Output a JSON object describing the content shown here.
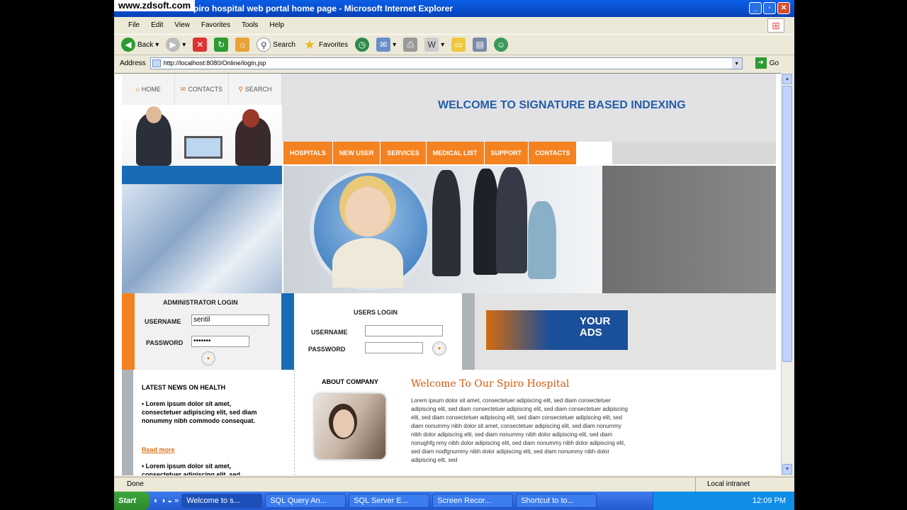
{
  "window": {
    "watermark": "www.zdsoft.com",
    "title": "Spiro hospital web portal home page - Microsoft Internet Explorer",
    "buttons": [
      "_",
      "▫",
      "✕"
    ]
  },
  "menubar": [
    "File",
    "Edit",
    "View",
    "Favorites",
    "Tools",
    "Help"
  ],
  "toolbar": {
    "back": "Back",
    "search": "Search",
    "favorites": "Favorites"
  },
  "address": {
    "label": "Address",
    "url": "http://localhost:8080/Online/login.jsp",
    "go": "Go"
  },
  "page": {
    "topnav": [
      "HOME",
      "CONTACTS",
      "SEARCH"
    ],
    "welcome": "WELCOME TO SIGNATURE BASED INDEXING",
    "orangenav": [
      "HOSPITALS",
      "NEW USER",
      "SERVICES",
      "MEDICAL LIST",
      "SUPPORT",
      "CONTACTS"
    ],
    "admin": {
      "title": "ADMINISTRATOR LOGIN",
      "username_label": "USERNAME",
      "username_value": "sentil",
      "password_label": "PASSWORD",
      "password_value": "•••••••"
    },
    "users": {
      "title": "USERS LOGIN",
      "username_label": "USERNAME",
      "username_value": "",
      "password_label": "PASSWORD",
      "password_value": ""
    },
    "ads": "YOUR ADS",
    "news": {
      "title": "LATEST NEWS ON HEALTH",
      "item1": "• Lorem ipsum dolor sit amet, consectetuer adipiscing elit, sed diam nonummy nibh commodo consequat.",
      "readmore": "Read more",
      "item2": "• Lorem ipsum dolor sit amet, consectetuer adipiscing elit, sed"
    },
    "about": {
      "title": "ABOUT COMPANY",
      "heading": "Welcome To Our Spiro Hospital",
      "body": "Lorem ipsum dolor sit amet, consectetuer adipiscing elit, sed diam consectetuer adipiscing elit, sed diam consectetuer adipiscing elit, sed diam consectetuer adipiscing elit, sed diam consectetuer adipiscing elit, sed diam consectetuer adipiscing elit, sed diam nonummy nibh dolor sit amet, consectetuer adipiscing elit, sed diam nonummy nibh dolor adipiscing elit, sed diam nonummy nibh dolor adipiscing elit, sed diam nonughfg nmy nibh dolor adipiscing elit, sed diam nonummy nibh dolor adipiscing elit, sed diam nodfgnummy nibh dolor adipiscing elit, sed diam nonummy nibh dolor adipiscing elit, sed"
    }
  },
  "status": {
    "left": "Done",
    "zone": "Local intranet"
  },
  "taskbar": {
    "start": "Start",
    "items": [
      "Welcome to s...",
      "SQL Query An...",
      "SQL Server E...",
      "Screen Recor...",
      "Shortcut to to..."
    ],
    "clock": "12:09 PM"
  },
  "colors": {
    "accent_orange": "#f58220",
    "accent_blue": "#1a6bb5",
    "welcome_text": "#245ea8"
  }
}
